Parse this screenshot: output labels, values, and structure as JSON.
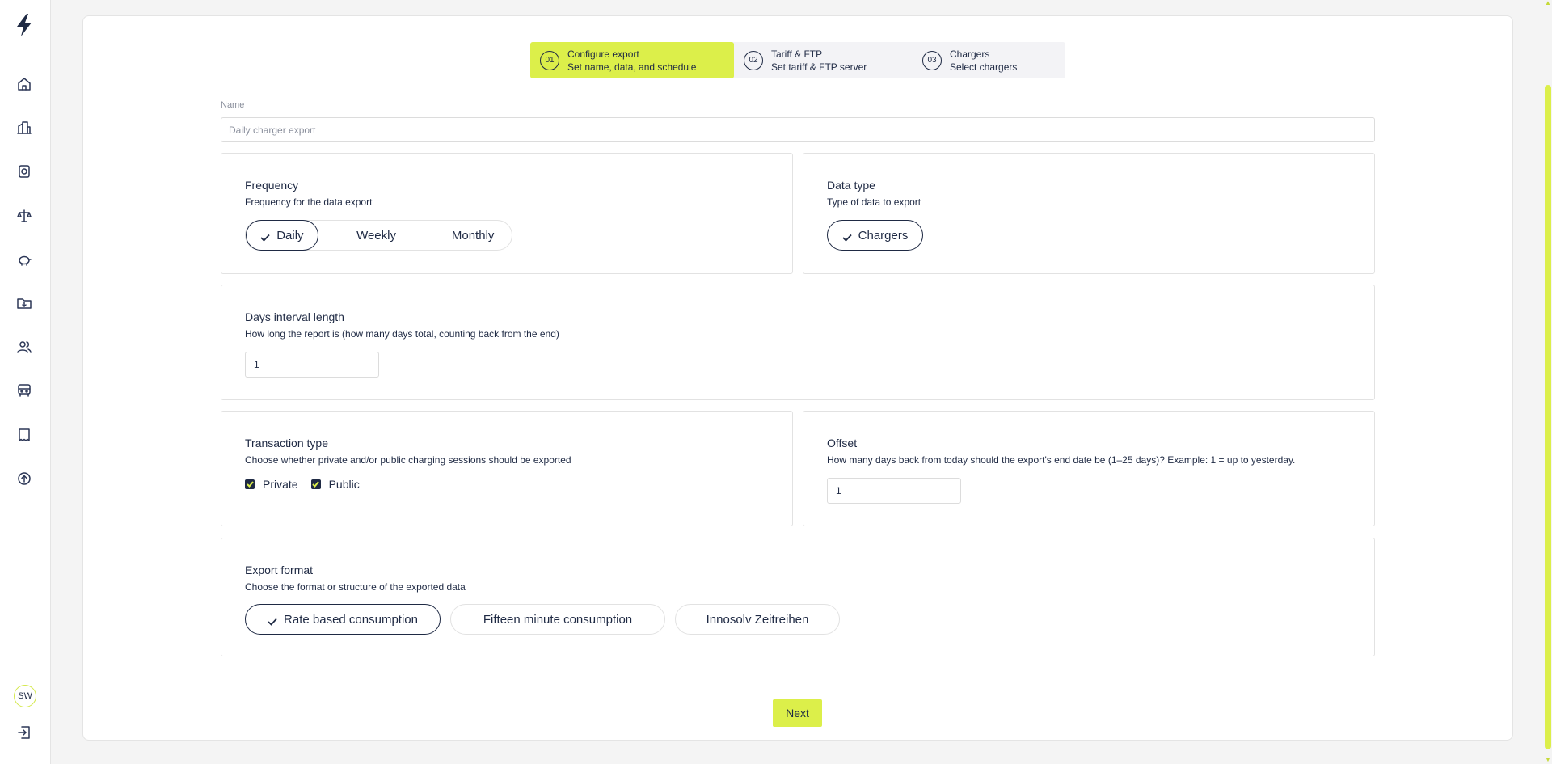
{
  "sidebar": {
    "logo": "bolt-logo-icon",
    "items": [
      {
        "icon": "home-icon"
      },
      {
        "icon": "buildings-icon"
      },
      {
        "icon": "charger-icon"
      },
      {
        "icon": "scales-icon"
      },
      {
        "icon": "piggy-bank-icon"
      },
      {
        "icon": "folder-download-icon"
      },
      {
        "icon": "users-icon"
      },
      {
        "icon": "vehicle-icon"
      },
      {
        "icon": "receipt-icon"
      },
      {
        "icon": "upload-icon"
      }
    ],
    "avatar_initials": "SW",
    "logout_icon": "logout-icon"
  },
  "stepper": {
    "steps": [
      {
        "num": "01",
        "title": "Configure export",
        "subtitle": "Set name, data, and schedule",
        "active": true
      },
      {
        "num": "02",
        "title": "Tariff & FTP",
        "subtitle": "Set tariff & FTP server",
        "active": false
      },
      {
        "num": "03",
        "title": "Chargers",
        "subtitle": "Select chargers",
        "active": false
      }
    ]
  },
  "name": {
    "label": "Name",
    "placeholder": "Daily charger export",
    "value": ""
  },
  "frequency": {
    "title": "Frequency",
    "description": "Frequency for the data export",
    "options": [
      "Daily",
      "Weekly",
      "Monthly"
    ],
    "selected": "Daily"
  },
  "data_type": {
    "title": "Data type",
    "description": "Type of data to export",
    "options": [
      "Chargers"
    ],
    "selected": "Chargers"
  },
  "days_interval": {
    "title": "Days interval length",
    "description": "How long the report is (how many days total, counting back from the end)",
    "value": "1"
  },
  "transaction_type": {
    "title": "Transaction type",
    "description": "Choose whether private and/or public charging sessions should be exported",
    "private_label": "Private",
    "public_label": "Public",
    "private_checked": true,
    "public_checked": true
  },
  "offset": {
    "title": "Offset",
    "description": "How many days back from today should the export's end date be (1–25 days)? Example: 1 = up to yesterday.",
    "value": "1"
  },
  "export_format": {
    "title": "Export format",
    "description": "Choose the format or structure of the exported data",
    "options": [
      "Rate based consumption",
      "Fifteen minute consumption",
      "Innosolv Zeitreihen"
    ],
    "selected": "Rate based consumption"
  },
  "actions": {
    "next_label": "Next"
  },
  "colors": {
    "accent": "#dcef4a",
    "text": "#1f2a44",
    "border": "#e2e2e2"
  }
}
